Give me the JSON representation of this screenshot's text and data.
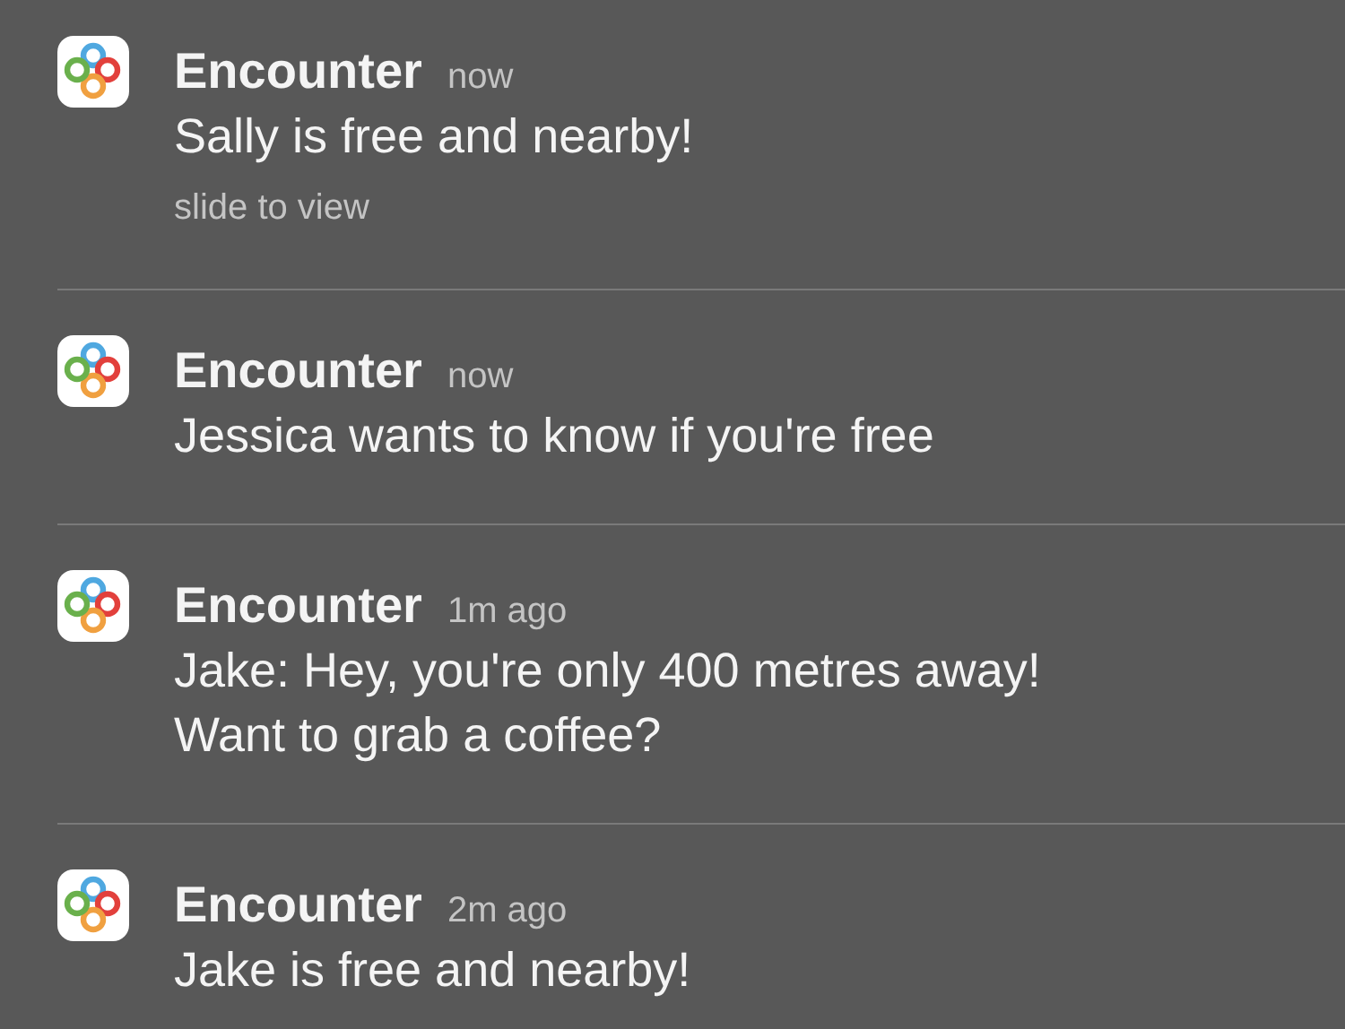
{
  "notifications": [
    {
      "app": "Encounter",
      "time": "now",
      "message": [
        "Sally is free and nearby!"
      ],
      "hint": "slide to view"
    },
    {
      "app": "Encounter",
      "time": "now",
      "message": [
        "Jessica wants to know if you're free"
      ]
    },
    {
      "app": "Encounter",
      "time": "1m ago",
      "message": [
        "Jake: Hey, you're only 400 metres away!",
        "Want to grab a coffee?"
      ]
    },
    {
      "app": "Encounter",
      "time": "2m ago",
      "message": [
        "Jake is free and nearby!"
      ]
    }
  ]
}
